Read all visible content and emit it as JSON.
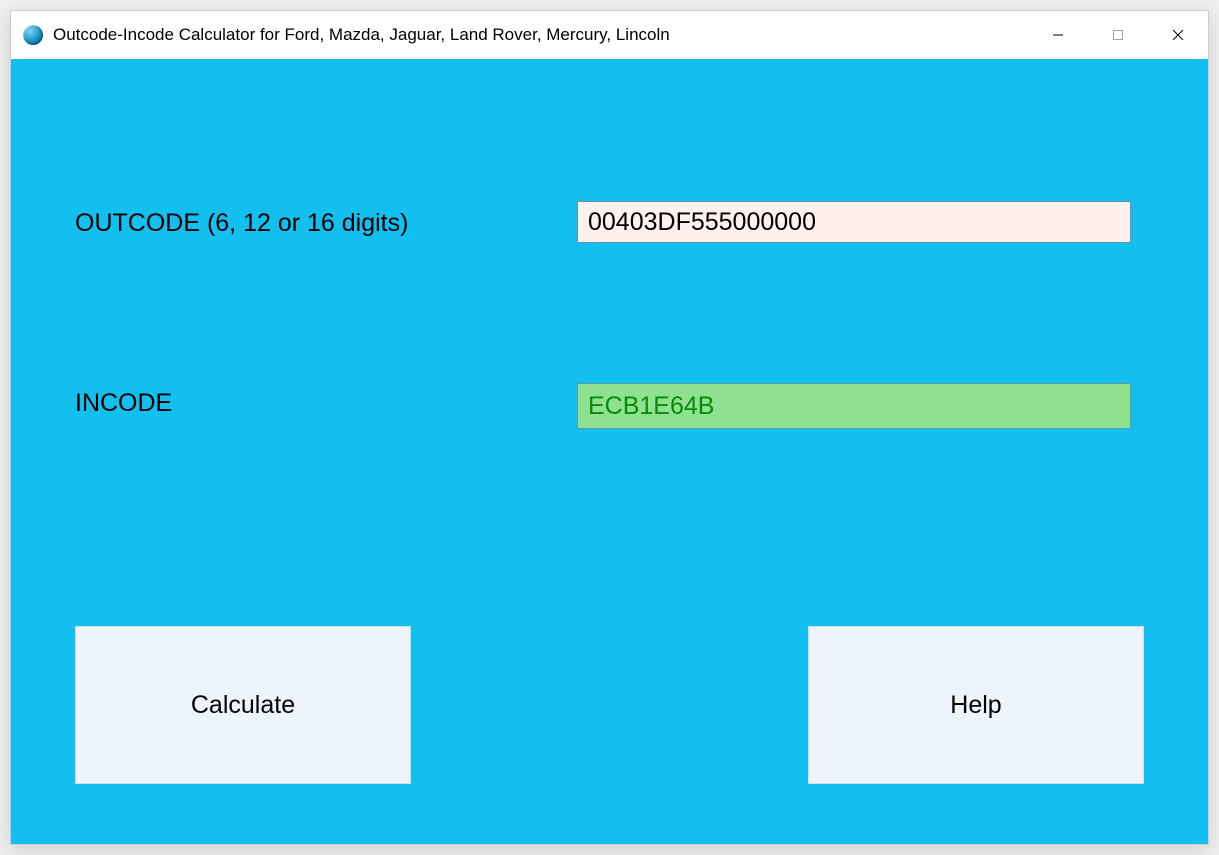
{
  "window": {
    "title": "Outcode-Incode Calculator for Ford, Mazda, Jaguar, Land Rover, Mercury, Lincoln"
  },
  "labels": {
    "outcode": "OUTCODE (6, 12 or 16 digits)",
    "incode": "INCODE"
  },
  "fields": {
    "outcode_value": "00403DF555000000",
    "incode_value": "ECB1E64B"
  },
  "buttons": {
    "calculate": "Calculate",
    "help": "Help"
  }
}
